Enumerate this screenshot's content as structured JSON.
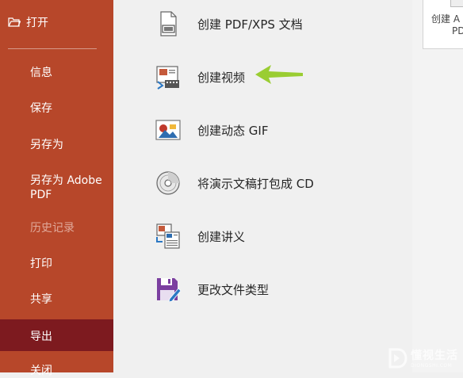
{
  "sidebar": {
    "open_label": "打开",
    "items": [
      {
        "label": "信息"
      },
      {
        "label": "保存"
      },
      {
        "label": "另存为"
      },
      {
        "label": "另存为 Adobe PDF"
      },
      {
        "label": "历史记录"
      },
      {
        "label": "打印"
      },
      {
        "label": "共享"
      },
      {
        "label": "导出"
      },
      {
        "label": "关闭"
      }
    ],
    "active_index": 7,
    "bg_color": "#b7472a",
    "active_color": "#7d1a1f"
  },
  "export_options": [
    {
      "label": "创建 PDF/XPS 文档",
      "icon": "pdf-document-icon"
    },
    {
      "label": "创建视频",
      "icon": "video-icon"
    },
    {
      "label": "创建动态 GIF",
      "icon": "gif-icon"
    },
    {
      "label": "将演示文稿打包成 CD",
      "icon": "cd-icon"
    },
    {
      "label": "创建讲义",
      "icon": "handout-icon"
    },
    {
      "label": "更改文件类型",
      "icon": "save-file-type-icon"
    }
  ],
  "right_card": {
    "line1": "创建 A",
    "line2": "PDF"
  },
  "annotation": {
    "arrow_color": "#9acd32"
  },
  "watermark": {
    "title": "懂视生活",
    "subtitle": "DIONGSHI.COM"
  }
}
